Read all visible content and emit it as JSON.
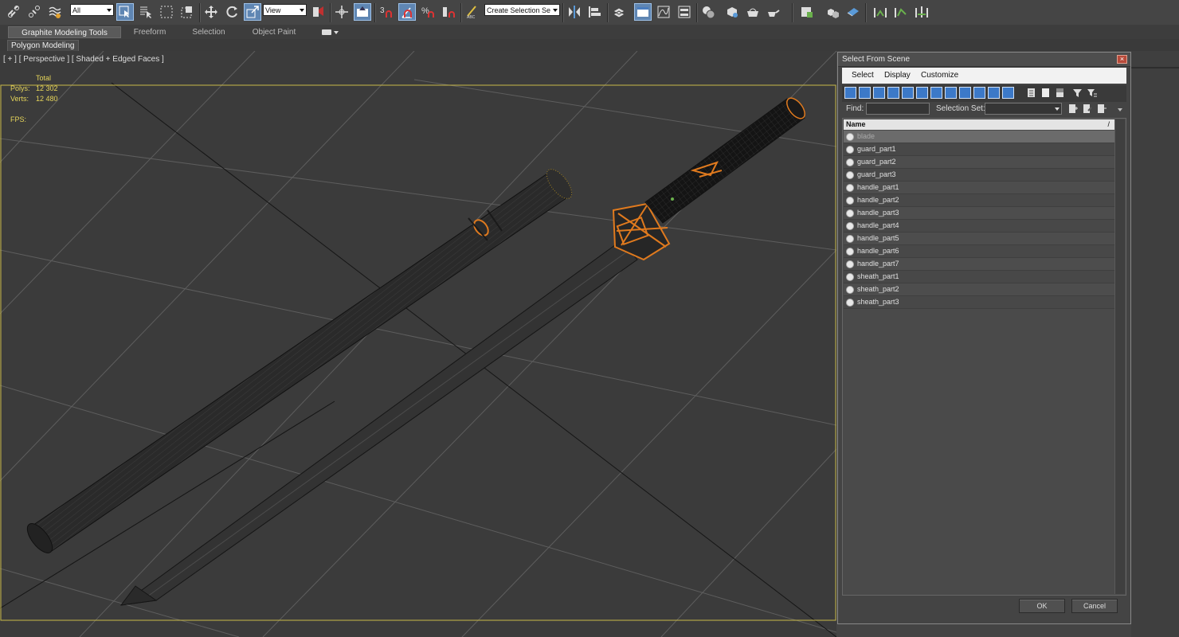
{
  "toolbar": {
    "filter_dropdown": "All",
    "refcoord_dropdown": "View",
    "named_selection_dropdown": "Create Selection Se",
    "snap_label": "3"
  },
  "ribbon": {
    "tabs": [
      "Graphite Modeling Tools",
      "Freeform",
      "Selection",
      "Object Paint"
    ],
    "active_tab": 0,
    "panel_label": "Polygon Modeling"
  },
  "viewport": {
    "label": "[ + ] [ Perspective ] [ Shaded + Edged Faces ]",
    "stats": {
      "total_label": "Total",
      "polys_label": "Polys:",
      "polys_value": "12 302",
      "verts_label": "Verts:",
      "verts_value": "12 480",
      "fps_label": "FPS:"
    },
    "colors": {
      "background": "#3b3b3b",
      "grid": "#5e5e5e",
      "frame": "#c8b84a",
      "selection": "#e07a1e"
    }
  },
  "dialog": {
    "title": "Select From Scene",
    "menu": [
      "Select",
      "Display",
      "Customize"
    ],
    "find_label": "Find:",
    "find_value": "",
    "selection_set_label": "Selection Set:",
    "column_header": "Name",
    "objects": [
      "blade",
      "guard_part1",
      "guard_part2",
      "guard_part3",
      "handle_part1",
      "handle_part2",
      "handle_part3",
      "handle_part4",
      "handle_part5",
      "handle_part6",
      "handle_part7",
      "sheath_part1",
      "sheath_part2",
      "sheath_part3"
    ],
    "selected_index": 0,
    "ok_label": "OK",
    "cancel_label": "Cancel"
  }
}
